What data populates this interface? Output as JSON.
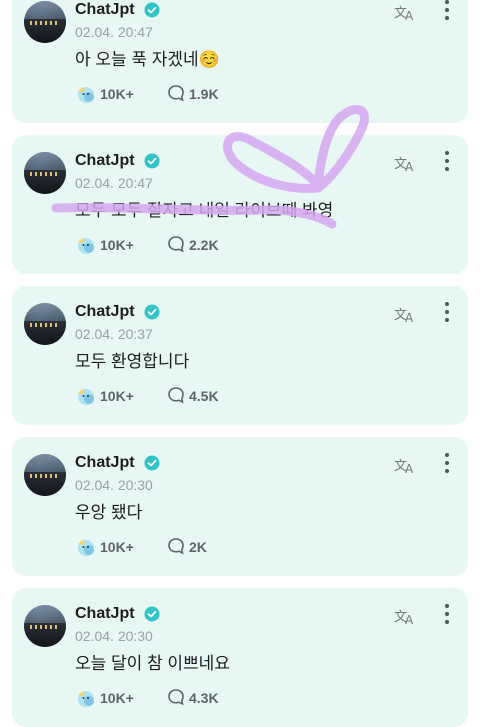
{
  "posts": [
    {
      "author": "ChatJpt",
      "timestamp": "02.04. 20:47",
      "message": "아 오늘 푹 자겠네☺️",
      "reactions": "10K+",
      "comments": "1.9K"
    },
    {
      "author": "ChatJpt",
      "timestamp": "02.04. 20:47",
      "message": "모두 모두 잘자고 내일 라이브때 봐영",
      "reactions": "10K+",
      "comments": "2.2K"
    },
    {
      "author": "ChatJpt",
      "timestamp": "02.04. 20:37",
      "message": "모두 환영합니다",
      "reactions": "10K+",
      "comments": "4.5K"
    },
    {
      "author": "ChatJpt",
      "timestamp": "02.04. 20:30",
      "message": "우앙 됐다",
      "reactions": "10K+",
      "comments": "2K"
    },
    {
      "author": "ChatJpt",
      "timestamp": "02.04. 20:30",
      "message": "오늘 달이 참 이쁘네요",
      "reactions": "10K+",
      "comments": "4.3K"
    }
  ],
  "colors": {
    "card_background": "#e7f7f3",
    "verified_badge": "#2ec4c9",
    "highlight_scribble": "#d6a6f0"
  },
  "icons": {
    "verified": "verified-badge-icon",
    "translate": "translate-icon",
    "more": "more-vertical-icon",
    "reaction": "reaction-emoji-icon",
    "comment": "comment-bubble-icon"
  }
}
